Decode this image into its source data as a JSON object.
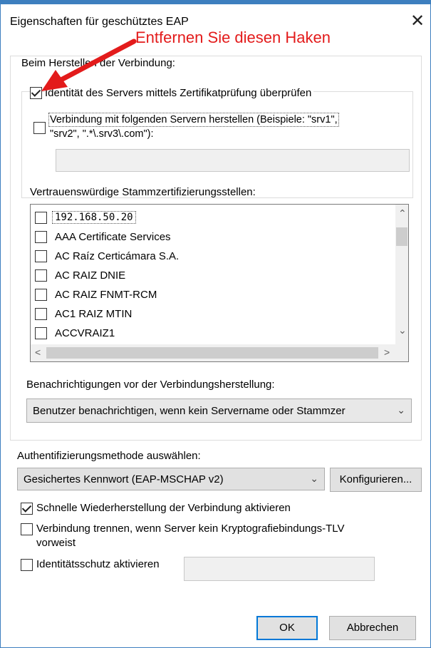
{
  "dialog": {
    "title": "Eigenschaften für geschütztes EAP",
    "close_glyph": "✕"
  },
  "annotation": {
    "text": "Entfernen Sie diesen Haken",
    "color": "#e31b1b"
  },
  "connection_group": {
    "label": "Beim Herstellen der Verbindung:",
    "verify_identity": {
      "label": "Identität des Servers mittels Zertifikatprüfung überprüfen",
      "checked": true
    },
    "connect_servers": {
      "label_line1": "Verbindung mit folgenden Servern herstellen (Beispiele: \"srv1\",",
      "label_line2": "\"srv2\", \".*\\.srv3\\.com\"):",
      "checked": false
    },
    "servers_input_value": "",
    "trusted_roots_label": "Vertrauenswürdige Stammzertifizierungsstellen:",
    "trusted_roots": [
      {
        "label": "192.168.50.20",
        "checked": false
      },
      {
        "label": "AAA Certificate Services",
        "checked": false
      },
      {
        "label": "AC Raíz Certicámara S.A.",
        "checked": false
      },
      {
        "label": "AC RAIZ DNIE",
        "checked": false
      },
      {
        "label": "AC RAIZ FNMT-RCM",
        "checked": false
      },
      {
        "label": "AC1 RAIZ MTIN",
        "checked": false
      },
      {
        "label": "ACCVRAIZ1",
        "checked": false
      }
    ],
    "notifications_label": "Benachrichtigungen vor der Verbindungsherstellung:",
    "notifications_value": "Benutzer benachrichtigen, wenn kein Servername oder Stammzer"
  },
  "auth": {
    "label": "Authentifizierungsmethode auswählen:",
    "method_value": "Gesichertes Kennwort (EAP-MSCHAP v2)",
    "configure_button": "Konfigurieren...",
    "fast_reconnect": {
      "label": "Schnelle Wiederherstellung der Verbindung aktivieren",
      "checked": true
    },
    "disconnect_tlv": {
      "label_line1": "Verbindung trennen, wenn Server kein Kryptografiebindungs-TLV",
      "label_line2": "vorweist",
      "checked": false
    },
    "identity_privacy": {
      "label": "Identitätsschutz aktivieren",
      "checked": false,
      "value": ""
    }
  },
  "buttons": {
    "ok": "OK",
    "cancel": "Abbrechen"
  }
}
